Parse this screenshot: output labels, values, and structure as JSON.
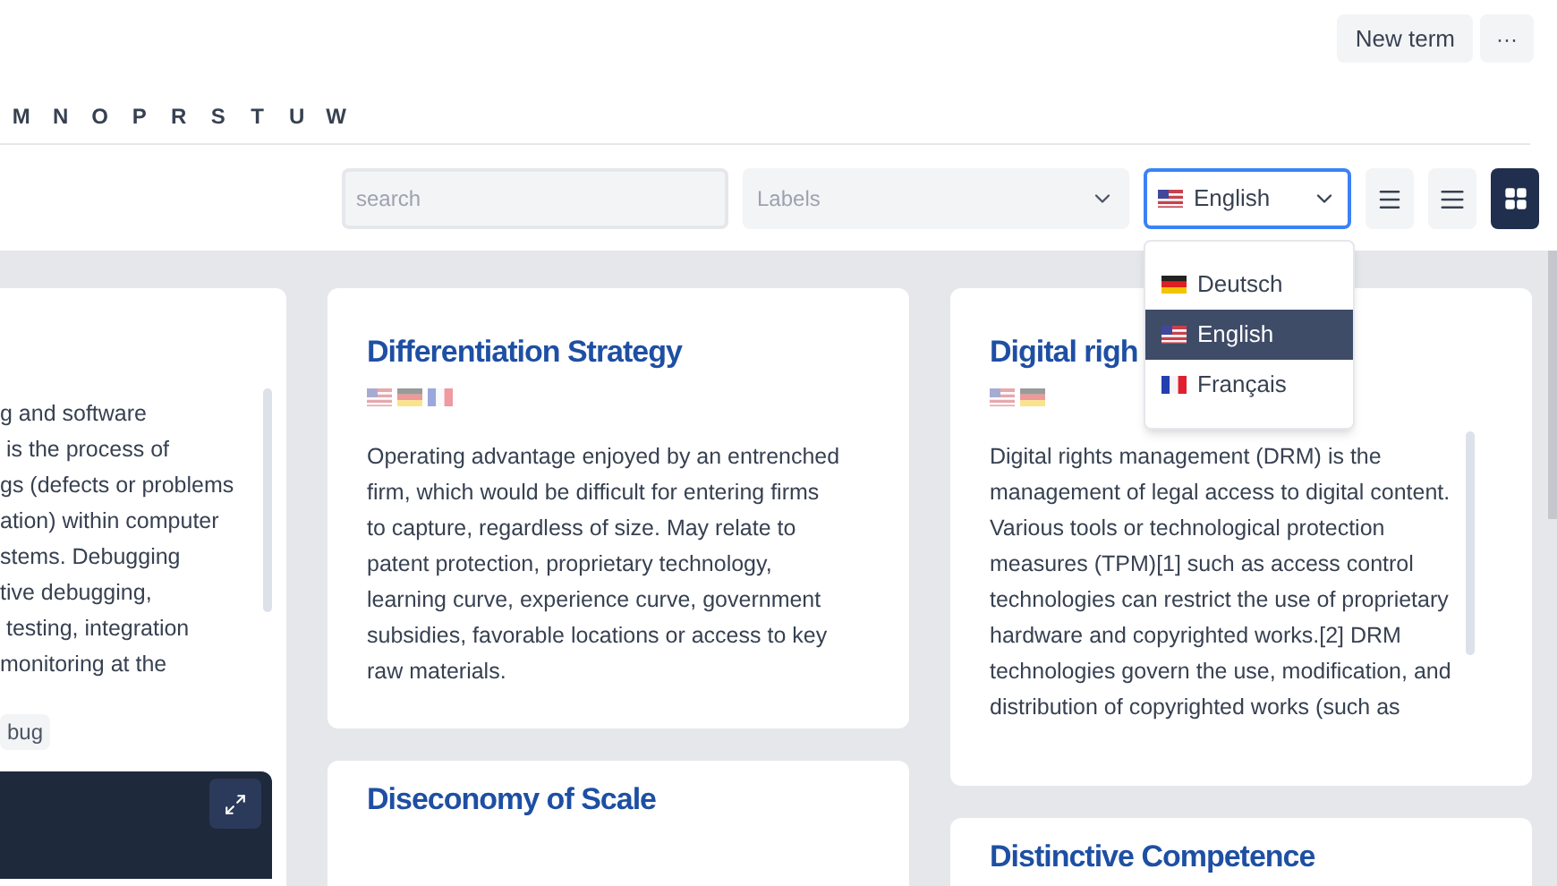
{
  "header": {
    "new_term": "New term",
    "more": "···"
  },
  "alphabet": [
    "M",
    "N",
    "O",
    "P",
    "R",
    "S",
    "T",
    "U",
    "W"
  ],
  "toolbar": {
    "search": {
      "placeholder": "search"
    },
    "labels": {
      "placeholder": "Labels"
    },
    "language": {
      "value": "English",
      "kind": "us",
      "open": true,
      "options": [
        {
          "label": "Deutsch",
          "kind": "de",
          "selected": false
        },
        {
          "label": "English",
          "kind": "us",
          "selected": true
        },
        {
          "label": "Français",
          "kind": "fr",
          "selected": false
        }
      ]
    },
    "views": [
      {
        "kind": "list",
        "selected": false
      },
      {
        "kind": "compact",
        "selected": false
      },
      {
        "kind": "grid",
        "selected": true
      }
    ]
  },
  "columns": [
    [
      {
        "text": "g and software\n is the process of\ngs (defects or problems\nation) within computer\nstems. Debugging\ntive debugging,\n testing, integration\nmonitoring at the",
        "scroll": true,
        "labels": [
          "bug"
        ],
        "preview": true
      }
    ],
    [
      {
        "title": "Differentiation Strategy",
        "flags": [
          {
            "kind": "us"
          },
          {
            "kind": "de"
          },
          {
            "kind": "fr"
          }
        ],
        "text": "Operating advantage enjoyed by an entrenched\nfirm, which would be difficult for entering firms\nto capture, regardless of size. May relate to\npatent protection, proprietary technology,\nlearning curve, experience curve, government\nsubsidies, favorable locations or access to key\nraw materials."
      },
      {
        "title": "Diseconomy of Scale"
      }
    ],
    [
      {
        "title": "Digital righ",
        "flags": [
          {
            "kind": "us"
          },
          {
            "kind": "de"
          }
        ],
        "text": "Digital rights management (DRM) is the\nmanagement of legal access to digital content.\nVarious tools or technological protection\nmeasures (TPM)[1] such as access control\ntechnologies can restrict the use of proprietary\nhardware and copyrighted works.[2] DRM\ntechnologies govern the use, modification, and\ndistribution of copyrighted works (such as",
        "scroll": true
      },
      {
        "title": "Distinctive Competence"
      }
    ]
  ]
}
